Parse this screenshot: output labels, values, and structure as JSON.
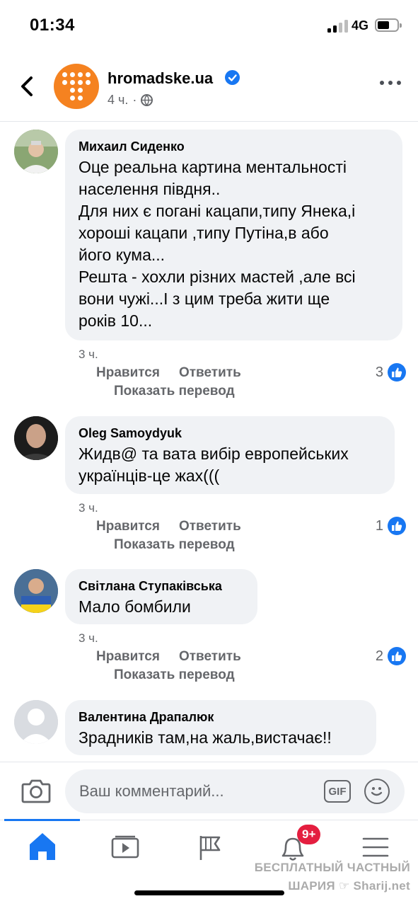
{
  "status_bar": {
    "time": "01:34",
    "network": "4G"
  },
  "header": {
    "page_name": "hromadske.ua",
    "post_time": "4 ч.",
    "separator": "·"
  },
  "comments": [
    {
      "author": "Михаил Сиденко",
      "text": "Оце реальна картина ментальності\nнаселення півдня..\nДля них є погані кацапи,типу Янека,і\nхороші кацапи ,типу Путіна,в або\nйого кума...\nРешта - хохли різних мастей ,але всі\nвони чужі...І  з цим треба жити ще\nроків 10...",
      "time": "3 ч.",
      "like_label": "Нравится",
      "reply_label": "Ответить",
      "translate_label": "Показать перевод",
      "reactions": "3"
    },
    {
      "author": "Oleg Samoydyuk",
      "text": "Жидв@ та вата вибір европейських\nукраїнців-це жах(((",
      "time": "3 ч.",
      "like_label": "Нравится",
      "reply_label": "Ответить",
      "translate_label": "Показать перевод",
      "reactions": "1"
    },
    {
      "author": "Світлана Ступаківська",
      "text": "Мало бомбили",
      "time": "3 ч.",
      "like_label": "Нравится",
      "reply_label": "Ответить",
      "translate_label": "Показать перевод",
      "reactions": "2"
    },
    {
      "author": "Валентина Драпалюк",
      "text": "Зрадників там,на жаль,вистачає!!"
    }
  ],
  "composer": {
    "placeholder": "Ваш комментарий...",
    "gif_label": "GIF"
  },
  "bottom_nav": {
    "items": [
      "home-icon",
      "watch-icon",
      "pages-icon",
      "notifications-icon",
      "menu-icon"
    ],
    "notifications_badge": "9+",
    "active": "home"
  },
  "watermark": {
    "line1": "БЕСПЛАТНЫЙ ЧАСТНЫЙ",
    "line2": "ШАРИЯ ☞ Sharij.net"
  },
  "colors": {
    "accent": "#1877f2",
    "brand_logo": "#f58220",
    "badge": "#e41e3f",
    "bubble": "#f0f2f5",
    "meta_text": "#65676b"
  }
}
